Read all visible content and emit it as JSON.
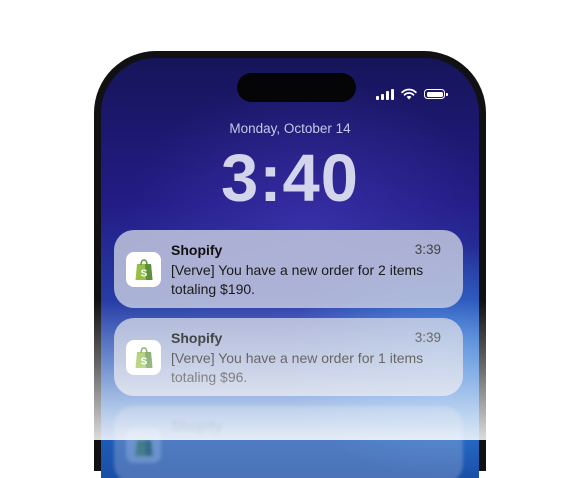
{
  "lockscreen": {
    "date": "Monday, October 14",
    "time": "3:40"
  },
  "status_bar": {
    "icons": [
      "cellular-signal-icon",
      "wifi-icon",
      "battery-icon"
    ]
  },
  "notifications": [
    {
      "app": "Shopify",
      "time": "3:39",
      "message": "[Verve] You have a new order for 2 items totaling $190.",
      "icon": "shopify-bag-icon"
    },
    {
      "app": "Shopify",
      "time": "3:39",
      "message": "[Verve] You have a new order for 1 items totaling $96.",
      "icon": "shopify-bag-icon"
    },
    {
      "app": "Shopify",
      "time": "",
      "message": "",
      "icon": "shopify-bag-icon"
    }
  ],
  "colors": {
    "shopify_green": "#95BF47",
    "shopify_dark_green": "#5E8E3E"
  }
}
